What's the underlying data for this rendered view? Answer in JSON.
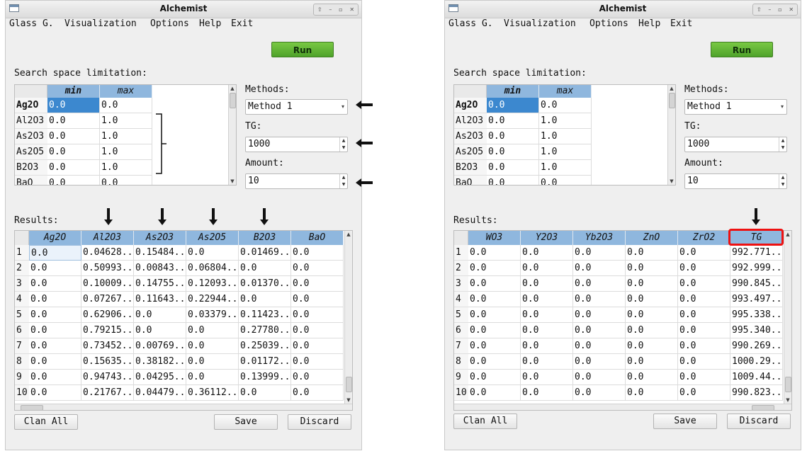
{
  "windows": [
    {
      "title": "Alchemist",
      "menu": [
        "Glass G.",
        "Visualization",
        "Options",
        "Help",
        "Exit"
      ],
      "run_label": "Run",
      "search_label": "Search space limitation:",
      "search": {
        "headers": [
          "min",
          "max"
        ],
        "rows": [
          {
            "name": "Ag2O",
            "min": "0.0",
            "max": "0.0"
          },
          {
            "name": "Al2O3",
            "min": "0.0",
            "max": "1.0"
          },
          {
            "name": "As2O3",
            "min": "0.0",
            "max": "1.0"
          },
          {
            "name": "As2O5",
            "min": "0.0",
            "max": "1.0"
          },
          {
            "name": "B2O3",
            "min": "0.0",
            "max": "1.0"
          },
          {
            "name": "BaO",
            "min": "0.0",
            "max": "0.0"
          }
        ]
      },
      "methods_label": "Methods:",
      "method_value": "Method 1",
      "tg_label": "TG:",
      "tg_value": "1000",
      "amount_label": "Amount:",
      "amount_value": "10",
      "results_label": "Results:",
      "results": {
        "headers": [
          "Ag2O",
          "Al2O3",
          "As2O3",
          "As2O5",
          "B2O3",
          "BaO"
        ],
        "rows": [
          [
            "0.0",
            "0.04628...",
            "0.15484...",
            "0.0",
            "0.01469...",
            "0.0"
          ],
          [
            "0.0",
            "0.50993...",
            "0.00843...",
            "0.06804...",
            "0.0",
            "0.0"
          ],
          [
            "0.0",
            "0.10009...",
            "0.14755...",
            "0.12093...",
            "0.01370...",
            "0.0"
          ],
          [
            "0.0",
            "0.07267...",
            "0.11643...",
            "0.22944...",
            "0.0",
            "0.0"
          ],
          [
            "0.0",
            "0.62906...",
            "0.0",
            "0.03379...",
            "0.11423...",
            "0.0"
          ],
          [
            "0.0",
            "0.79215...",
            "0.0",
            "0.0",
            "0.27780...",
            "0.0"
          ],
          [
            "0.0",
            "0.73452...",
            "0.00769...",
            "0.0",
            "0.25039...",
            "0.0"
          ],
          [
            "0.0",
            "0.15635...",
            "0.38182...",
            "0.0",
            "0.01172...",
            "0.0"
          ],
          [
            "0.0",
            "0.94743...",
            "0.04295...",
            "0.0",
            "0.13999...",
            "0.0"
          ],
          [
            "0.0",
            "0.21767...",
            "0.04479...",
            "0.36112...",
            "0.0",
            "0.0"
          ]
        ]
      },
      "buttons": {
        "clean": "Clan All",
        "save": "Save",
        "discard": "Discard"
      }
    },
    {
      "title": "Alchemist",
      "menu": [
        "Glass G.",
        "Visualization",
        "Options",
        "Help",
        "Exit"
      ],
      "run_label": "Run",
      "search_label": "Search space limitation:",
      "search": {
        "headers": [
          "min",
          "max"
        ],
        "rows": [
          {
            "name": "Ag2O",
            "min": "0.0",
            "max": "0.0"
          },
          {
            "name": "Al2O3",
            "min": "0.0",
            "max": "1.0"
          },
          {
            "name": "As2O3",
            "min": "0.0",
            "max": "1.0"
          },
          {
            "name": "As2O5",
            "min": "0.0",
            "max": "1.0"
          },
          {
            "name": "B2O3",
            "min": "0.0",
            "max": "1.0"
          },
          {
            "name": "BaO",
            "min": "0.0",
            "max": "0.0"
          }
        ]
      },
      "methods_label": "Methods:",
      "method_value": "Method 1",
      "tg_label": "TG:",
      "tg_value": "1000",
      "amount_label": "Amount:",
      "amount_value": "10",
      "results_label": "Results:",
      "results": {
        "headers": [
          "WO3",
          "Y2O3",
          "Yb2O3",
          "ZnO",
          "ZrO2",
          "TG"
        ],
        "rows": [
          [
            "0.0",
            "0.0",
            "0.0",
            "0.0",
            "0.0",
            "992.771..."
          ],
          [
            "0.0",
            "0.0",
            "0.0",
            "0.0",
            "0.0",
            "992.999..."
          ],
          [
            "0.0",
            "0.0",
            "0.0",
            "0.0",
            "0.0",
            "990.845..."
          ],
          [
            "0.0",
            "0.0",
            "0.0",
            "0.0",
            "0.0",
            "993.497..."
          ],
          [
            "0.0",
            "0.0",
            "0.0",
            "0.0",
            "0.0",
            "995.338..."
          ],
          [
            "0.0",
            "0.0",
            "0.0",
            "0.0",
            "0.0",
            "995.340..."
          ],
          [
            "0.0",
            "0.0",
            "0.0",
            "0.0",
            "0.0",
            "990.269..."
          ],
          [
            "0.0",
            "0.0",
            "0.0",
            "0.0",
            "0.0",
            "1000.29..."
          ],
          [
            "0.0",
            "0.0",
            "0.0",
            "0.0",
            "0.0",
            "1009.44..."
          ],
          [
            "0.0",
            "0.0",
            "0.0",
            "0.0",
            "0.0",
            "990.823..."
          ]
        ]
      },
      "buttons": {
        "clean": "Clan All",
        "save": "Save",
        "discard": "Discard"
      }
    }
  ],
  "colors": {
    "header_blue": "#8fb7de",
    "selected_blue": "#3c88cf",
    "run_green": "#5fb335",
    "highlight_red": "#e11111"
  }
}
